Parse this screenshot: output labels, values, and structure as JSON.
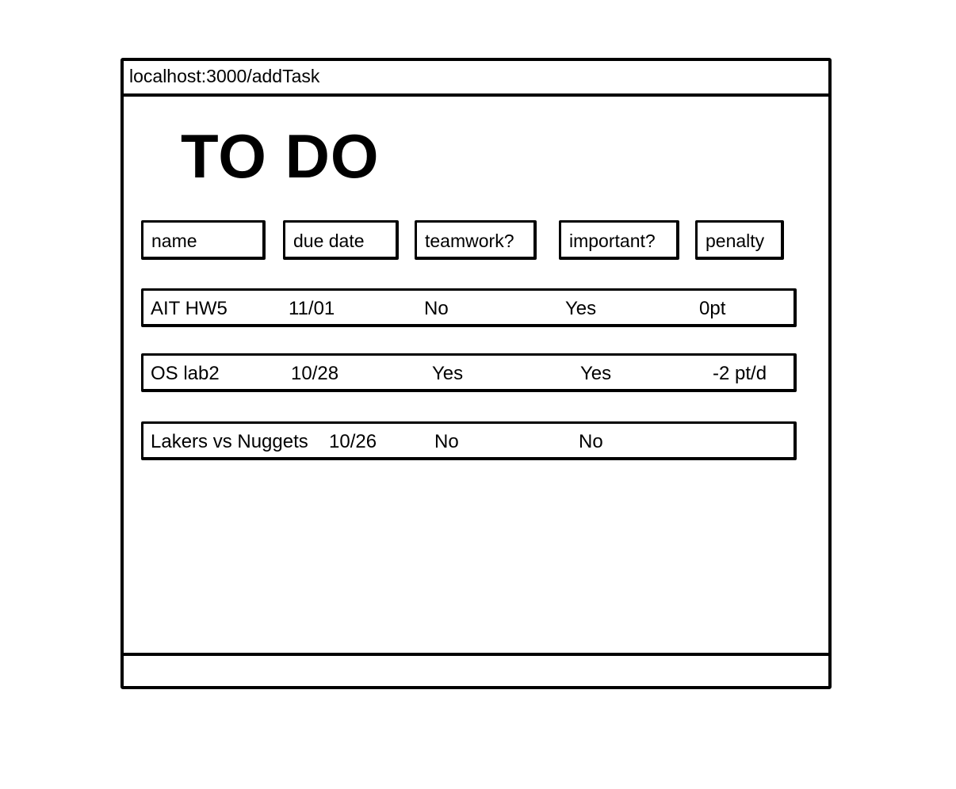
{
  "browser": {
    "url": "localhost:3000/addTask"
  },
  "page": {
    "title": "TO DO"
  },
  "headers": [
    "name",
    "due date",
    "teamwork?",
    "important?",
    "penalty"
  ],
  "tasks": [
    {
      "name": "AIT HW5",
      "due": "11/01",
      "teamwork": "No",
      "important": "Yes",
      "penalty": "0pt"
    },
    {
      "name": "OS lab2",
      "due": "10/28",
      "teamwork": "Yes",
      "important": "Yes",
      "penalty": "-2 pt/d"
    },
    {
      "name": "Lakers vs Nuggets",
      "due": "10/26",
      "teamwork": "No",
      "important": "No",
      "penalty": ""
    }
  ]
}
